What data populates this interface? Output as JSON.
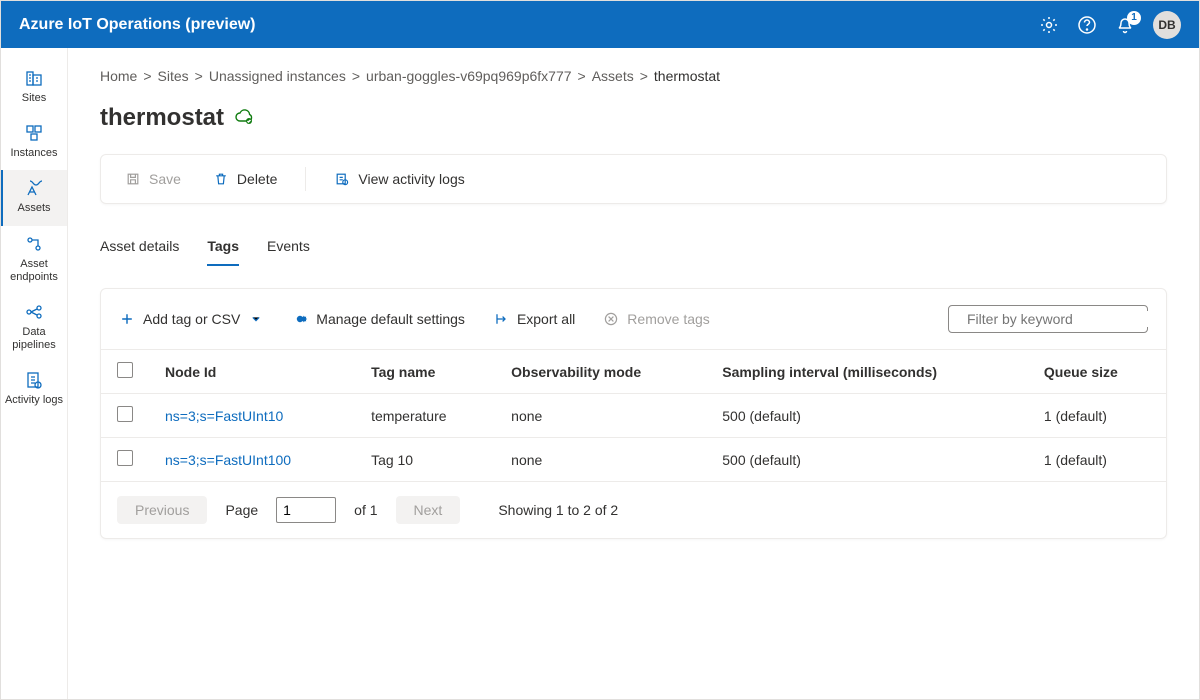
{
  "header": {
    "title": "Azure IoT Operations (preview)",
    "notification_count": "1",
    "avatar_initials": "DB"
  },
  "nav": {
    "items": [
      {
        "label": "Sites",
        "icon": "building-icon"
      },
      {
        "label": "Instances",
        "icon": "instance-icon"
      },
      {
        "label": "Assets",
        "icon": "asset-icon"
      },
      {
        "label": "Asset endpoints",
        "icon": "endpoint-icon"
      },
      {
        "label": "Data pipelines",
        "icon": "pipeline-icon"
      },
      {
        "label": "Activity logs",
        "icon": "logs-icon"
      }
    ],
    "active_index": 2
  },
  "breadcrumbs": {
    "items": [
      "Home",
      "Sites",
      "Unassigned instances",
      "urban-goggles-v69pq969p6fx777",
      "Assets",
      "thermostat"
    ]
  },
  "page": {
    "title": "thermostat"
  },
  "toolbar": {
    "save_label": "Save",
    "delete_label": "Delete",
    "logs_label": "View activity logs"
  },
  "tabs": {
    "items": [
      "Asset details",
      "Tags",
      "Events"
    ],
    "active_index": 1
  },
  "tags_panel": {
    "add_label": "Add tag or CSV",
    "manage_label": "Manage default settings",
    "export_label": "Export all",
    "remove_label": "Remove tags",
    "filter_placeholder": "Filter by keyword",
    "columns": [
      "Node Id",
      "Tag name",
      "Observability mode",
      "Sampling interval (milliseconds)",
      "Queue size"
    ],
    "rows": [
      {
        "node_id": "ns=3;s=FastUInt10",
        "tag_name": "temperature",
        "obs_mode": "none",
        "sampling": "500 (default)",
        "queue": "1 (default)"
      },
      {
        "node_id": "ns=3;s=FastUInt100",
        "tag_name": "Tag 10",
        "obs_mode": "none",
        "sampling": "500 (default)",
        "queue": "1 (default)"
      }
    ],
    "pager": {
      "prev_label": "Previous",
      "next_label": "Next",
      "page_label": "Page",
      "page_value": "1",
      "of_label": "of 1",
      "summary": "Showing 1 to 2 of 2"
    }
  }
}
